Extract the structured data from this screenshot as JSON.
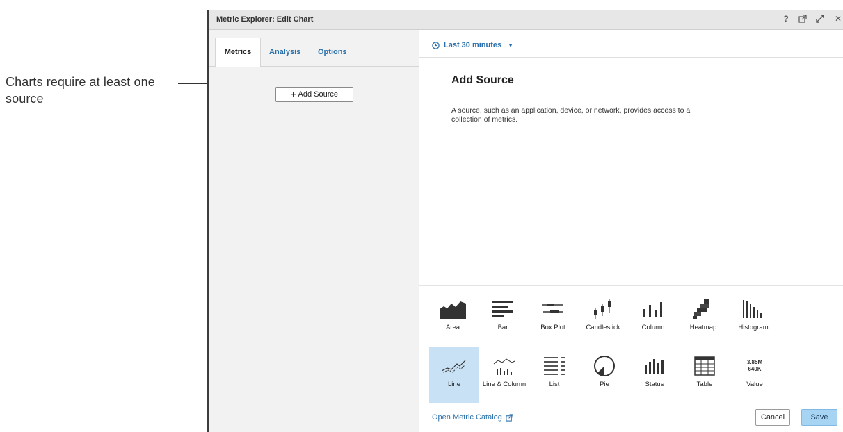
{
  "annotation": {
    "text": "Charts require at least one source"
  },
  "dialog": {
    "title": "Metric Explorer: Edit Chart",
    "title_icons": [
      {
        "name": "help-icon",
        "glyph": "?"
      },
      {
        "name": "open-external-icon"
      },
      {
        "name": "expand-icon"
      },
      {
        "name": "close-icon",
        "glyph": "✕"
      }
    ]
  },
  "tabs": [
    {
      "label": "Metrics",
      "active": true
    },
    {
      "label": "Analysis",
      "active": false
    },
    {
      "label": "Options",
      "active": false
    }
  ],
  "left": {
    "add_source_label": "Add Source",
    "add_source_plus": "+"
  },
  "right": {
    "time_range": "Last 30 minutes",
    "heading": "Add Source",
    "description": "A source, such as an application, device, or network, provides access to a collection of metrics."
  },
  "chart_types": [
    {
      "label": "Area",
      "icon": "area-chart-icon",
      "selected": false
    },
    {
      "label": "Bar",
      "icon": "bar-chart-icon",
      "selected": false
    },
    {
      "label": "Box Plot",
      "icon": "box-plot-icon",
      "selected": false
    },
    {
      "label": "Candlestick",
      "icon": "candlestick-icon",
      "selected": false
    },
    {
      "label": "Column",
      "icon": "column-chart-icon",
      "selected": false
    },
    {
      "label": "Heatmap",
      "icon": "heatmap-icon",
      "selected": false
    },
    {
      "label": "Histogram",
      "icon": "histogram-icon",
      "selected": false
    },
    {
      "label": "Line",
      "icon": "line-chart-icon",
      "selected": true
    },
    {
      "label": "Line & Column",
      "icon": "line-column-icon",
      "selected": false
    },
    {
      "label": "List",
      "icon": "list-icon",
      "selected": false
    },
    {
      "label": "Pie",
      "icon": "pie-chart-icon",
      "selected": false
    },
    {
      "label": "Status",
      "icon": "status-icon",
      "selected": false
    },
    {
      "label": "Table",
      "icon": "table-icon",
      "selected": false
    },
    {
      "label": "Value",
      "icon": "value-icon",
      "selected": false
    }
  ],
  "value_icon_text": {
    "top": "3.85M",
    "bottom": "640K"
  },
  "footer": {
    "catalog_link": "Open Metric Catalog",
    "cancel": "Cancel",
    "save": "Save"
  },
  "colors": {
    "accent": "#2a6fa9",
    "selected_bg": "#c8e1f5",
    "save_bg": "#a8d4f4",
    "titlebar": "#e7e7e7",
    "left_panel": "#f2f2f2"
  }
}
